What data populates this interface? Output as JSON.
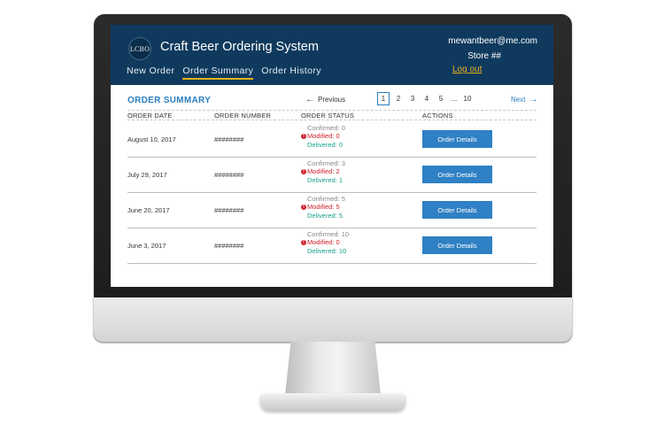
{
  "app": {
    "logo_text": "LCBO",
    "title": "Craft Beer Ordering System"
  },
  "nav": {
    "tabs": [
      {
        "label": "New Order"
      },
      {
        "label": "Order Summary",
        "active": true
      },
      {
        "label": "Order History"
      }
    ]
  },
  "user": {
    "email": "mewantbeer@me.com",
    "store": "Store ##",
    "logout_label": "Log out"
  },
  "summary": {
    "title": "ORDER SUMMARY",
    "prev_label": "Previous",
    "next_label": "Next",
    "pages": [
      "1",
      "2",
      "3",
      "4",
      "5",
      "...",
      "10"
    ],
    "current_page": "1",
    "columns": [
      "ORDER DATE",
      "ORDER NUMBER",
      "ORDER STATUS",
      "ACTIONS"
    ],
    "rows": [
      {
        "date": "August 10, 2017",
        "number": "########",
        "confirmed": "Confirmed: 0",
        "modified": "Modified: 0",
        "delivered": "Delivered: 0",
        "action": "Order Details"
      },
      {
        "date": "July 29, 2017",
        "number": "########",
        "confirmed": "Confirmed: 3",
        "modified": "Modified: 2",
        "delivered": "Delivered: 1",
        "action": "Order Details"
      },
      {
        "date": "June 20, 2017",
        "number": "########",
        "confirmed": "Confirmed: 5",
        "modified": "Modified: 5",
        "delivered": "Delivered: 5",
        "action": "Order Details"
      },
      {
        "date": "June 3, 2017",
        "number": "########",
        "confirmed": "Confirmed: 10",
        "modified": "Modified: 0",
        "delivered": "Delivered: 10",
        "action": "Order Details"
      }
    ]
  },
  "colors": {
    "header_bg": "#0f3a5e",
    "accent": "#2a7fc1",
    "active_underline": "#e7b31b",
    "modified": "#d0202a",
    "delivered": "#17a08a"
  },
  "icons": {
    "prev": "arrow-left-icon",
    "next": "arrow-right-icon",
    "modified": "info-icon"
  }
}
